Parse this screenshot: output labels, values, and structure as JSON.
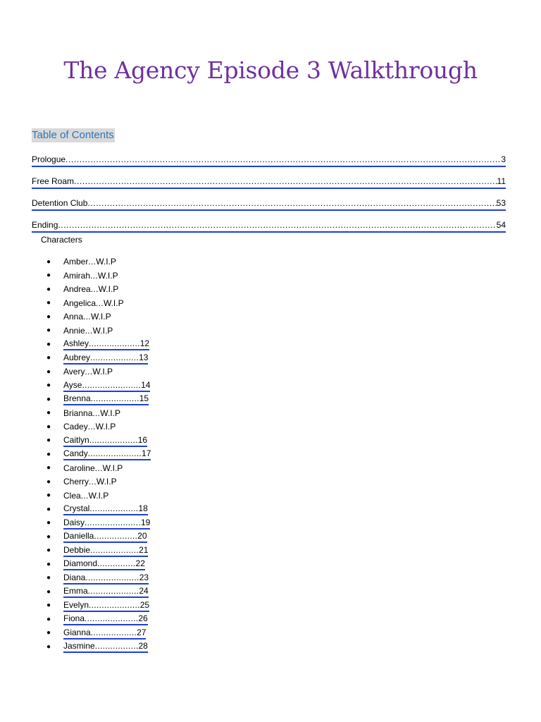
{
  "title": "The Agency Episode 3 Walkthrough",
  "toc": {
    "heading": "Table of Contents",
    "entries": [
      {
        "label": "Prologue",
        "page": "3"
      },
      {
        "label": "Free Roam",
        "page": "11"
      },
      {
        "label": "Detention Club",
        "page": "53"
      },
      {
        "label": "Ending",
        "page": "54"
      }
    ]
  },
  "characters": {
    "heading": "Characters",
    "items": [
      {
        "name": "Amber",
        "sep": "...",
        "page": "W.I.P",
        "linked": false
      },
      {
        "name": "Amirah",
        "sep": "...",
        "page": "W.I.P",
        "linked": false
      },
      {
        "name": "Andrea",
        "sep": "...",
        "page": "W.I.P",
        "linked": false
      },
      {
        "name": "Angelica",
        "sep": "...",
        "page": "W.I.P",
        "linked": false
      },
      {
        "name": "Anna",
        "sep": "...",
        "page": "W.I.P",
        "linked": false
      },
      {
        "name": "Annie",
        "sep": "...",
        "page": "W.I.P",
        "linked": false
      },
      {
        "name": "Ashley",
        "sep": "....................",
        "page": "12",
        "linked": true
      },
      {
        "name": "Aubrey",
        "sep": "...................",
        "page": "13",
        "linked": true
      },
      {
        "name": "Avery",
        "sep": "...",
        "page": "W.I.P",
        "linked": false
      },
      {
        "name": "Ayse",
        "sep": ".......................",
        "page": "14",
        "linked": true
      },
      {
        "name": "Brenna",
        "sep": "...................",
        "page": "15",
        "linked": true
      },
      {
        "name": "Brianna",
        "sep": "...",
        "page": "W.I.P",
        "linked": false
      },
      {
        "name": "Cadey",
        "sep": "...",
        "page": "W.I.P",
        "linked": false
      },
      {
        "name": "Caitlyn",
        "sep": "...................",
        "page": "16",
        "linked": true
      },
      {
        "name": "Candy",
        "sep": ".....................",
        "page": "17",
        "linked": true
      },
      {
        "name": "Caroline",
        "sep": "...",
        "page": "W.I.P",
        "linked": false
      },
      {
        "name": "Cherry",
        "sep": "...",
        "page": "W.I.P",
        "linked": false
      },
      {
        "name": "Clea",
        "sep": "...",
        "page": "W.I.P",
        "linked": false
      },
      {
        "name": "Crystal",
        "sep": "...................",
        "page": "18",
        "linked": true
      },
      {
        "name": "Daisy",
        "sep": "......................",
        "page": "19",
        "linked": true
      },
      {
        "name": "Daniella",
        "sep": ".................",
        "page": "20",
        "linked": true
      },
      {
        "name": "Debbie",
        "sep": "...................",
        "page": "21",
        "linked": true
      },
      {
        "name": "Diamond",
        "sep": "...............",
        "page": "22",
        "linked": true
      },
      {
        "name": "Diana",
        "sep": ".....................",
        "page": "23",
        "linked": true
      },
      {
        "name": "Emma",
        "sep": "....................",
        "page": "24",
        "linked": true
      },
      {
        "name": "Evelyn",
        "sep": "....................",
        "page": "25",
        "linked": true
      },
      {
        "name": "Fiona",
        "sep": ".....................",
        "page": "26",
        "linked": true
      },
      {
        "name": "Gianna",
        "sep": "..................",
        "page": "27",
        "linked": true
      },
      {
        "name": "Jasmine",
        "sep": ".................",
        "page": "28",
        "linked": true
      }
    ]
  },
  "colors": {
    "title": "#7030a0",
    "toc_heading": "#2e74b5",
    "link_underline": "#1f3fd6"
  }
}
